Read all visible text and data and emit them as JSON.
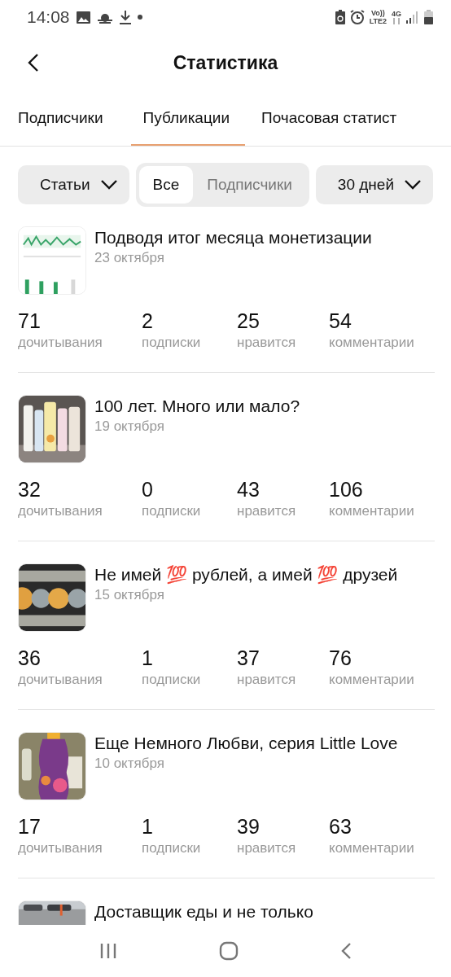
{
  "status_bar": {
    "time": "14:08",
    "volte": "Vo))",
    "lte": "LTE2",
    "network": "4G"
  },
  "header": {
    "title": "Статистика"
  },
  "tabs": [
    {
      "label": "Подписчики",
      "selected": false
    },
    {
      "label": "Публикации",
      "selected": true
    },
    {
      "label": "Почасовая статист",
      "selected": false
    }
  ],
  "filters": {
    "type_dropdown": "Статьи",
    "segments": [
      {
        "label": "Все",
        "selected": true
      },
      {
        "label": "Подписчики",
        "selected": false
      }
    ],
    "period_dropdown": "30 дней"
  },
  "posts": [
    {
      "title": "Подводя итог месяца монетизации",
      "date": "23 октября",
      "stats": [
        {
          "value": "71",
          "label": "дочитывания"
        },
        {
          "value": "2",
          "label": "подписки"
        },
        {
          "value": "25",
          "label": "нравится"
        },
        {
          "value": "54",
          "label": "комментарии"
        }
      ]
    },
    {
      "title": "100 лет. Много или мало?",
      "date": "19 октября",
      "stats": [
        {
          "value": "32",
          "label": "дочитывания"
        },
        {
          "value": "0",
          "label": "подписки"
        },
        {
          "value": "43",
          "label": "нравится"
        },
        {
          "value": "106",
          "label": "комментарии"
        }
      ]
    },
    {
      "title": "Не имей 💯 рублей, а имей 💯 друзей",
      "date": "15 октября",
      "stats": [
        {
          "value": "36",
          "label": "дочитывания"
        },
        {
          "value": "1",
          "label": "подписки"
        },
        {
          "value": "37",
          "label": "нравится"
        },
        {
          "value": "76",
          "label": "комментарии"
        }
      ]
    },
    {
      "title": "Еще Немного Любви, серия Little Love",
      "date": "10 октября",
      "stats": [
        {
          "value": "17",
          "label": "дочитывания"
        },
        {
          "value": "1",
          "label": "подписки"
        },
        {
          "value": "39",
          "label": "нравится"
        },
        {
          "value": "63",
          "label": "комментарии"
        }
      ]
    },
    {
      "title": "Доставщик еды и не только"
    }
  ]
}
